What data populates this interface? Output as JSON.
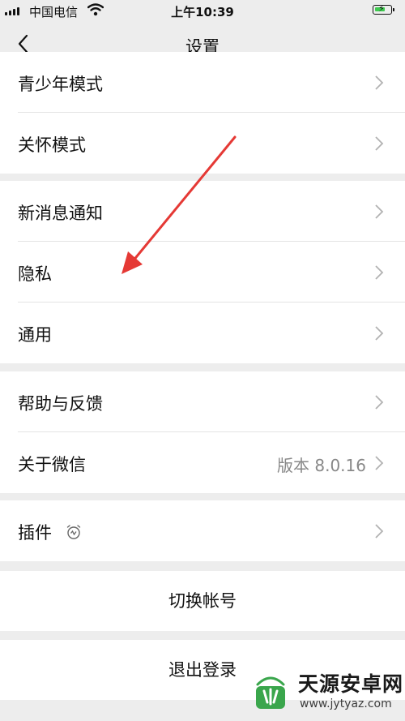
{
  "status_bar": {
    "carrier": "中国电信",
    "time": "上午10:39",
    "battery_level": 0.7
  },
  "nav": {
    "title": "设置"
  },
  "groups": [
    {
      "items": [
        {
          "label": "青少年模式"
        },
        {
          "label": "关怀模式"
        }
      ]
    },
    {
      "items": [
        {
          "label": "新消息通知"
        },
        {
          "label": "隐私"
        },
        {
          "label": "通用"
        }
      ]
    },
    {
      "items": [
        {
          "label": "帮助与反馈"
        },
        {
          "label": "关于微信",
          "value": "版本 8.0.16"
        }
      ]
    },
    {
      "items": [
        {
          "label": "插件"
        }
      ]
    }
  ],
  "actions": {
    "switch_account": "切换帐号",
    "logout": "退出登录"
  },
  "watermark": {
    "title": "天源安卓网",
    "url": "www.jytyaz.com"
  },
  "colors": {
    "annotation_arrow": "#e53935",
    "battery": "#3ec94f",
    "background": "#ededed"
  },
  "icons": [
    "back-icon",
    "chevron-right-icon",
    "plugin-icon",
    "wifi-icon",
    "battery-icon"
  ]
}
